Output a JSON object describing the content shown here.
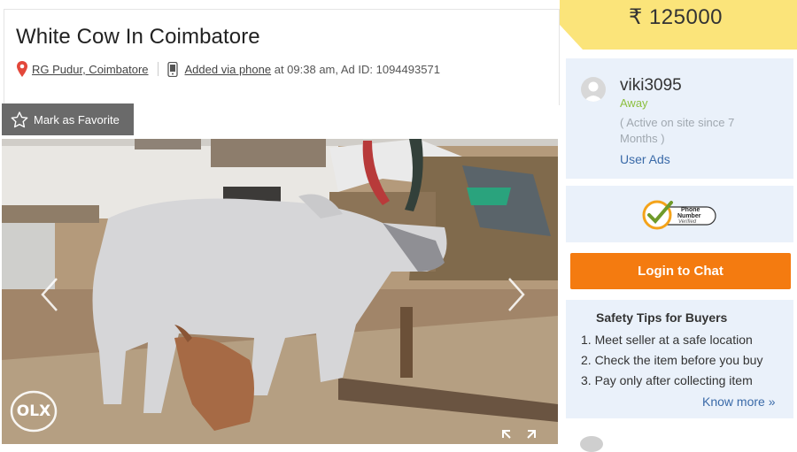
{
  "listing": {
    "title": "White Cow In Coimbatore",
    "location": "RG Pudur, Coimbatore",
    "added_via": "Added via phone",
    "added_rest": " at 09:38 am, Ad ID: 1094493571"
  },
  "favorite": {
    "label": "Mark as Favorite"
  },
  "price": {
    "text": "₹ 125000"
  },
  "seller": {
    "name": "viki3095",
    "status": "Away",
    "since": "( Active on site since 7 Months )",
    "user_ads_label": "User Ads"
  },
  "verified": {
    "line1": "Phone",
    "line2": "Number",
    "line3": "Verified"
  },
  "chat": {
    "label": "Login to Chat"
  },
  "safety": {
    "title": "Safety Tips for Buyers",
    "tips": [
      "1. Meet seller at a safe location",
      "2. Check the item before you buy",
      "3. Pay only after collecting item"
    ],
    "know_more": "Know more »"
  },
  "logo": {
    "text": "OLX"
  },
  "colors": {
    "accent_orange": "#f47b10",
    "price_yellow": "#fbe47a",
    "card_blue": "#eaf1fa",
    "status_green": "#8cbf3f",
    "link_blue": "#3a6aa8"
  }
}
